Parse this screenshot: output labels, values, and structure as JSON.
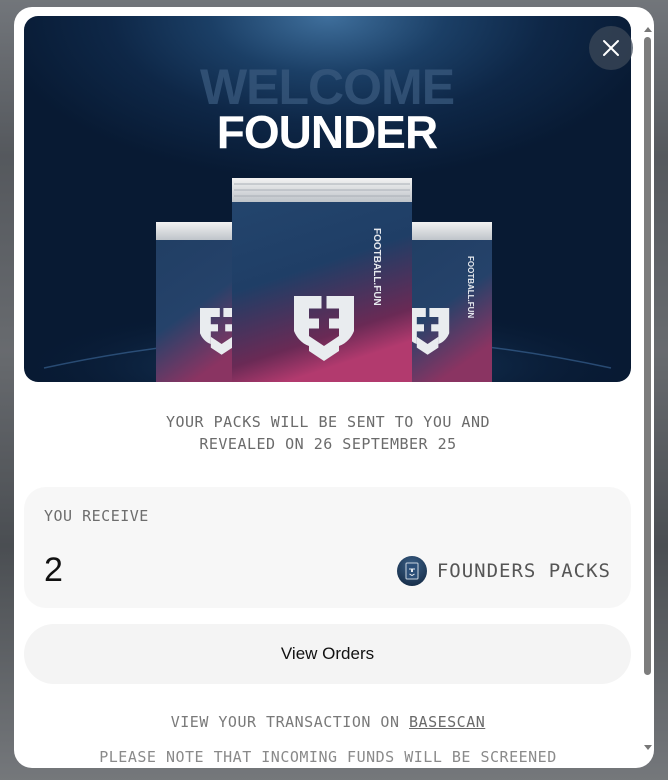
{
  "hero": {
    "headline_top": "WELCOME",
    "headline_main": "FOUNDER",
    "pack_brand": "FOOTBALL.FUN",
    "pack_logo": "ff-shield-logo"
  },
  "close_icon": "close-icon",
  "notice": {
    "line1": "YOUR PACKS WILL BE SENT TO YOU AND",
    "line2": "REVEALED ON 26 SEPTEMBER 25"
  },
  "receive": {
    "label": "YOU RECEIVE",
    "quantity": "2",
    "pack_name": "FOUNDERS PACKS",
    "pack_icon": "founders-pack-icon"
  },
  "view_orders_label": "View Orders",
  "transaction": {
    "prefix": "VIEW YOUR TRANSACTION ON",
    "link_text": "BASESCAN"
  },
  "note": "PLEASE NOTE THAT INCOMING FUNDS WILL BE SCREENED",
  "colors": {
    "hero_dark": "#0e2747",
    "hero_light": "#3f6f9c",
    "pack_pink": "#b23a6e",
    "card_bg": "#f7f7f7"
  }
}
